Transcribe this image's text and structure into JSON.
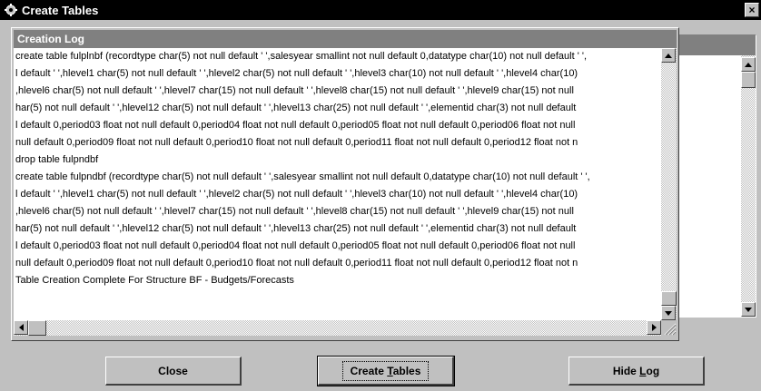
{
  "window": {
    "title": "Create Tables",
    "close_label": "×"
  },
  "log": {
    "header": "Creation Log",
    "lines": [
      "create table fulplnbf (recordtype char(5) not null default ' ',salesyear smallint not null default 0,datatype char(10) not null default ' ',",
      "l default ' ',hlevel1 char(5) not null default ' ',hlevel2 char(5) not null default ' ',hlevel3 char(10) not null default ' ',hlevel4 char(10)",
      ",hlevel6 char(5) not null default ' ',hlevel7 char(15) not null default ' ',hlevel8 char(15) not null default ' ',hlevel9 char(15) not null",
      "har(5) not null default ' ',hlevel12 char(5) not null default ' ',hlevel13 char(25) not null default ' ',elementid char(3) not null default",
      "l default 0,period03 float not null default 0,period04 float not null default 0,period05 float not null default 0,period06 float not null",
      "null default 0,period09 float not null default 0,period10 float not null default 0,period11 float not null default 0,period12 float not n",
      "drop table fulpndbf",
      "create table fulpndbf (recordtype char(5) not null default ' ',salesyear smallint not null default 0,datatype char(10) not null default ' ',",
      "l default ' ',hlevel1 char(5) not null default ' ',hlevel2 char(5) not null default ' ',hlevel3 char(10) not null default ' ',hlevel4 char(10)",
      ",hlevel6 char(5) not null default ' ',hlevel7 char(15) not null default ' ',hlevel8 char(15) not null default ' ',hlevel9 char(15) not null",
      "har(5) not null default ' ',hlevel12 char(5) not null default ' ',hlevel13 char(25) not null default ' ',elementid char(3) not null default",
      "l default 0,period03 float not null default 0,period04 float not null default 0,period05 float not null default 0,period06 float not null",
      "null default 0,period09 float not null default 0,period10 float not null default 0,period11 float not null default 0,period12 float not n",
      "Table Creation Complete For Structure BF - Budgets/Forecasts"
    ]
  },
  "buttons": {
    "close": "Close",
    "create_tables_prefix": "Create ",
    "create_tables_hotkey": "T",
    "create_tables_suffix": "ables",
    "hide_log_prefix": "Hide ",
    "hide_log_hotkey": "L",
    "hide_log_suffix": "og"
  },
  "icons": {
    "app": "gear-icon",
    "close": "close-icon",
    "scroll_up": "arrow-up-icon",
    "scroll_down": "arrow-down-icon",
    "scroll_left": "arrow-left-icon",
    "scroll_right": "arrow-right-icon",
    "resize": "resize-grip-icon"
  },
  "colors": {
    "title_bar": "#000000",
    "face": "#c0c0c0",
    "header": "#808080"
  }
}
